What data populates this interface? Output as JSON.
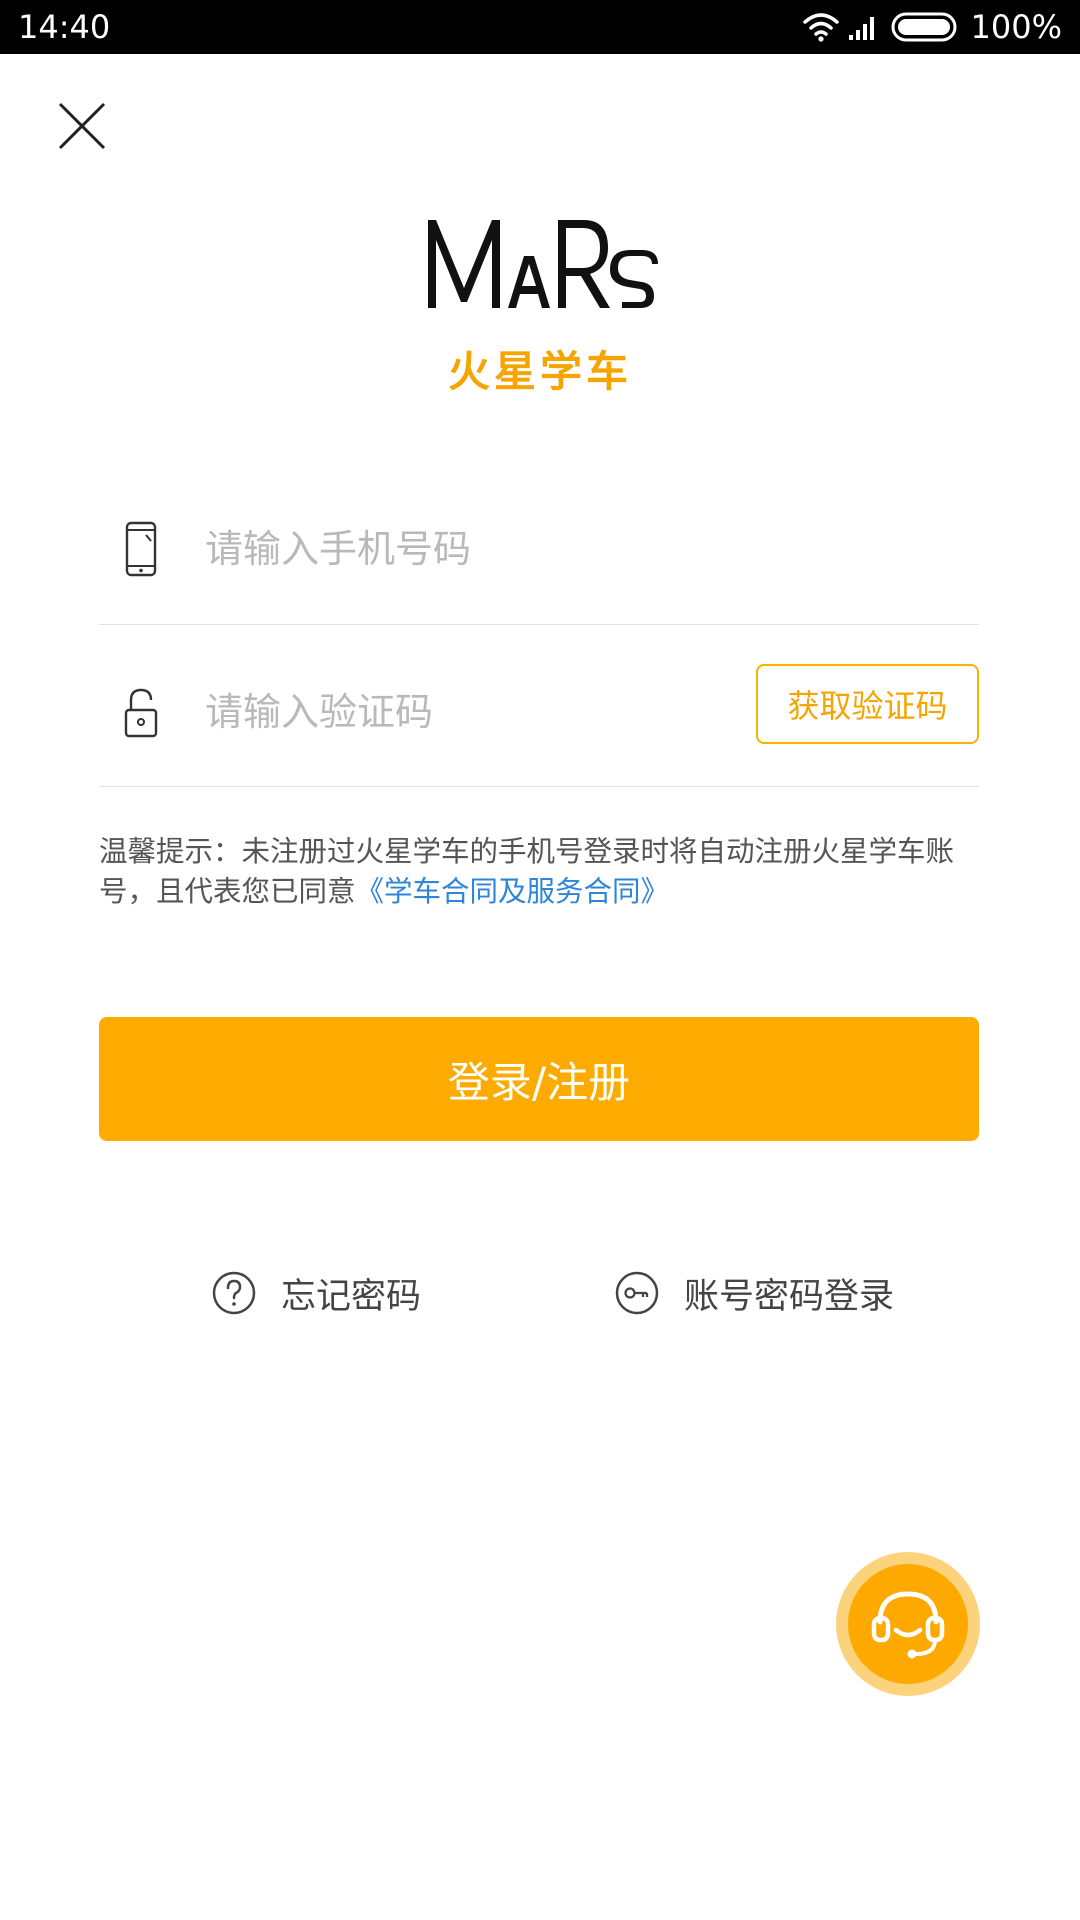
{
  "status_bar": {
    "time": "14:40",
    "battery": "100%",
    "icons": [
      "wifi-icon",
      "signal-icon",
      "battery-icon"
    ]
  },
  "header": {
    "close_icon": "close-icon"
  },
  "logo": {
    "wordmark": "MARS",
    "subtitle": "火星学车"
  },
  "form": {
    "phone": {
      "icon": "phone-icon",
      "value": "",
      "placeholder": "请输入手机号码"
    },
    "code": {
      "icon": "lock-icon",
      "value": "",
      "placeholder": "请输入验证码",
      "get_code_label": "获取验证码"
    }
  },
  "tip": {
    "text": "温馨提示：未注册过火星学车的手机号登录时将自动注册火星学车账号，且代表您已同意",
    "link": "《学车合同及服务合同》"
  },
  "login_button": "登录/注册",
  "alt_links": {
    "forgot_password": "忘记密码",
    "account_login": "账号密码登录"
  },
  "support": {
    "icon": "headset-icon"
  },
  "colors": {
    "accent": "#fdab00",
    "link": "#2f86d8",
    "placeholder": "#b9b9b9"
  }
}
